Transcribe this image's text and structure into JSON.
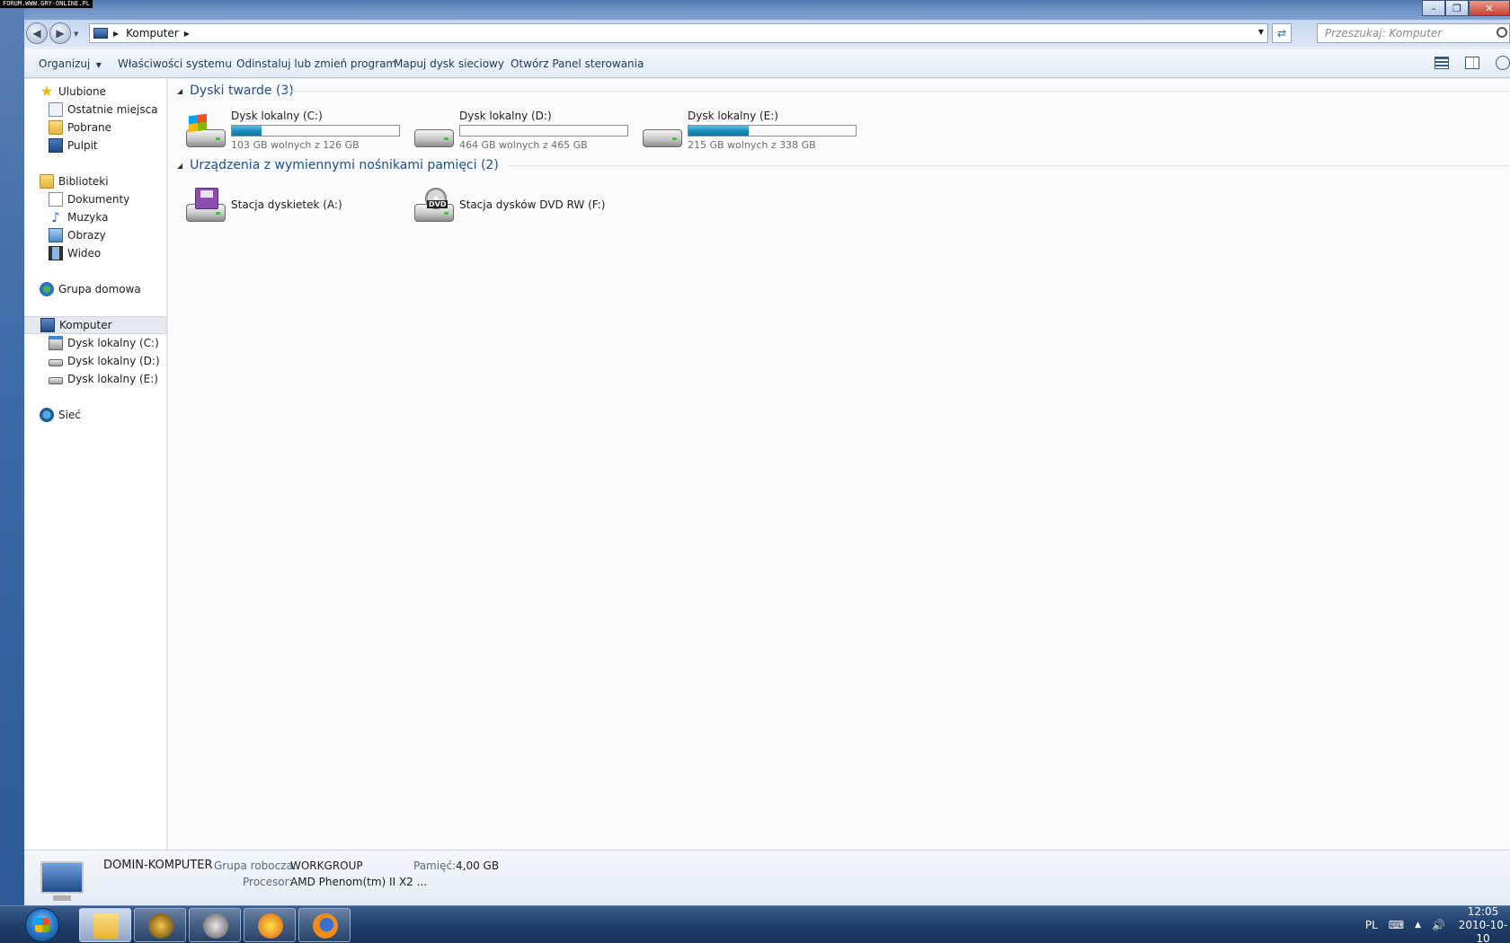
{
  "watermark": "FORUM.WWW.GRY-ONLINE.PL",
  "address": {
    "crumb": "Komputer"
  },
  "search": {
    "placeholder": "Przeszukaj: Komputer"
  },
  "toolbar": {
    "organize": "Organizuj",
    "system_properties": "Właściwości systemu",
    "uninstall": "Odinstaluj lub zmień program",
    "map_drive": "Mapuj dysk sieciowy",
    "control_panel": "Otwórz Panel sterowania"
  },
  "navpane": {
    "favorites": "Ulubione",
    "recent": "Ostatnie miejsca",
    "downloads": "Pobrane",
    "desktop": "Pulpit",
    "libraries": "Biblioteki",
    "documents": "Dokumenty",
    "music": "Muzyka",
    "pictures": "Obrazy",
    "videos": "Wideo",
    "homegroup": "Grupa domowa",
    "computer": "Komputer",
    "drive_c": "Dysk lokalny (C:)",
    "drive_d": "Dysk lokalny (D:)",
    "drive_e": "Dysk lokalny (E:)",
    "network": "Sieć"
  },
  "content": {
    "hard_drives_header": "Dyski twarde (3)",
    "removable_header": "Urządzenia z wymiennymi nośnikami pamięci (2)",
    "drives": [
      {
        "name": "Dysk lokalny (C:)",
        "space": "103 GB wolnych z 126 GB",
        "used_fraction": 0.18
      },
      {
        "name": "Dysk lokalny (D:)",
        "space": "464 GB wolnych z 465 GB",
        "used_fraction": 0.0
      },
      {
        "name": "Dysk lokalny (E:)",
        "space": "215 GB wolnych z 338 GB",
        "used_fraction": 0.36
      }
    ],
    "removable": [
      {
        "name": "Stacja dyskietek (A:)",
        "icon": "floppy-drive-icon"
      },
      {
        "name": "Stacja dysków DVD RW (F:)",
        "icon": "dvd-drive-icon",
        "badge": "DVD"
      }
    ]
  },
  "details": {
    "computer_name": "DOMIN-KOMPUTER",
    "workgroup_label": "Grupa robocza:",
    "workgroup": "WORKGROUP",
    "memory_label": "Pamięć:",
    "memory": "4,00 GB",
    "processor_label": "Procesor:",
    "processor": "AMD Phenom(tm) II X2 ..."
  },
  "tray": {
    "lang": "PL",
    "time": "12:05",
    "date": "2010-10-10"
  }
}
